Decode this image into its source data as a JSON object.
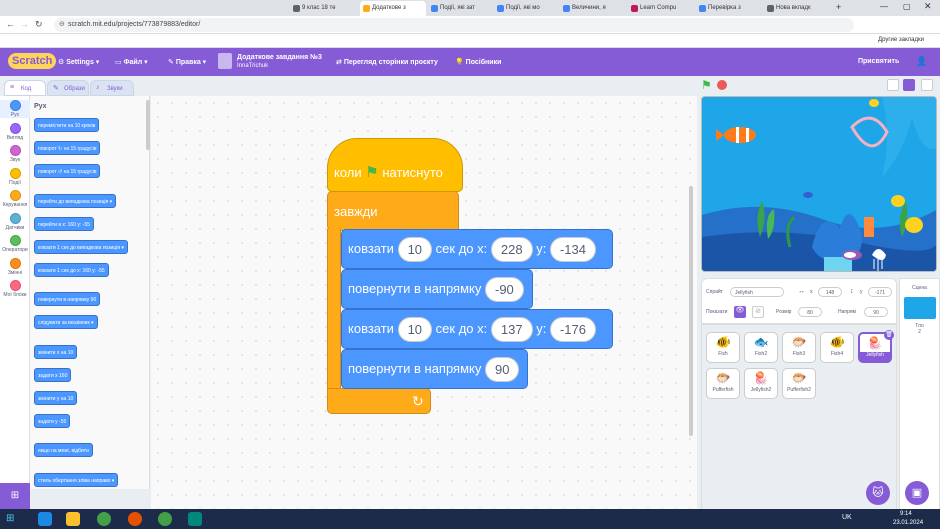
{
  "browser": {
    "tabs": [
      "9 клас 18 те",
      "Додаткове з",
      "Події, які зат",
      "Події, які мо",
      "Величини, я",
      "Learn Compu",
      "Перевірка з",
      "Нова вкладк"
    ],
    "url": "scratch.mit.edu/projects/773879883/editor/",
    "bookmarks": "Другие закладки"
  },
  "menubar": {
    "logo": "Scratch",
    "settings": "Settings",
    "file": "Файл",
    "edit": "Правка",
    "project_title": "Додаткове завдання №3",
    "author": "InnaTrichuk",
    "see_project": "Перегляд сторінки проєкту",
    "tutorials": "Посібники",
    "share": "Присвятить"
  },
  "editor_tabs": [
    "Код",
    "Образи",
    "Звуки"
  ],
  "categories": [
    {
      "label": "Рух",
      "color": "#4c97ff"
    },
    {
      "label": "Вигляд",
      "color": "#9966ff"
    },
    {
      "label": "Звук",
      "color": "#cf63cf"
    },
    {
      "label": "Події",
      "color": "#ffbf00"
    },
    {
      "label": "Керування",
      "color": "#ffab19"
    },
    {
      "label": "Датчики",
      "color": "#5cb1d6"
    },
    {
      "label": "Оператори",
      "color": "#59c059"
    },
    {
      "label": "Змінні",
      "color": "#ff8c1a"
    },
    {
      "label": "Мої блоки",
      "color": "#ff6680"
    }
  ],
  "palette": {
    "title": "Рух",
    "blocks": [
      "перемістити на 10 кроків",
      "поворот ↻ на 15 градусів",
      "поворот ↺ на 15 градусів",
      "перейти до випадкова позиція ▾",
      "перейти в x: 160 y: -55",
      "ковзати 1 сек до випадкова позиція ▾",
      "ковзати 1 сек до x: 160 y: -55",
      "повернути в напрямку 90",
      "слідувати за вказівник ▾",
      "змінити x на 10",
      "задати x 160",
      "змінити y на 10",
      "задати y -55",
      "якщо на межі, відбити",
      "стиль обертання зліва направо ▾"
    ]
  },
  "script": {
    "hat": {
      "label_before": "коли",
      "label_after": "натиснуто"
    },
    "forever": "завжди",
    "blocks": [
      {
        "label": "ковзати",
        "secs": "10",
        "mid": "сек до х:",
        "x": "228",
        "ylabel": "у:",
        "y": "-134"
      },
      {
        "label": "повернути в напрямку",
        "dir": "-90"
      },
      {
        "label": "ковзати",
        "secs": "10",
        "mid": "сек до х:",
        "x": "137",
        "ylabel": "у:",
        "y": "-176"
      },
      {
        "label": "повернути в напрямку",
        "dir": "90"
      }
    ]
  },
  "sprite_info": {
    "sprite_label": "Спрайт",
    "sprite_name": "Jellyfish",
    "x_label": "x",
    "x": "148",
    "y_label": "у",
    "y": "-171",
    "show_label": "Показати",
    "size_label": "Розмір",
    "size": "80",
    "direction_label": "Напрям",
    "direction": "90"
  },
  "sprites": [
    {
      "name": "Fish",
      "icon": "🐠"
    },
    {
      "name": "Fish2",
      "icon": "🐟"
    },
    {
      "name": "Fish3",
      "icon": "🐡"
    },
    {
      "name": "Fish4",
      "icon": "🐠"
    },
    {
      "name": "Jellyfish",
      "icon": "🪼"
    },
    {
      "name": "Pufferfish",
      "icon": "🐡"
    },
    {
      "name": "Jellyfish2",
      "icon": "🪼"
    },
    {
      "name": "Pufferfish2",
      "icon": "🐡"
    }
  ],
  "stage_pane": {
    "label": "Сцена",
    "backdrops_label": "Тло",
    "backdrops": "2"
  },
  "taskbar": {
    "lang": "UK",
    "time": "9:14",
    "date": "23.01.2024"
  },
  "colors": {
    "scratch_purple": "#855cd6",
    "motion": "#4c97ff",
    "control": "#ffab19",
    "events": "#ffbf00"
  }
}
